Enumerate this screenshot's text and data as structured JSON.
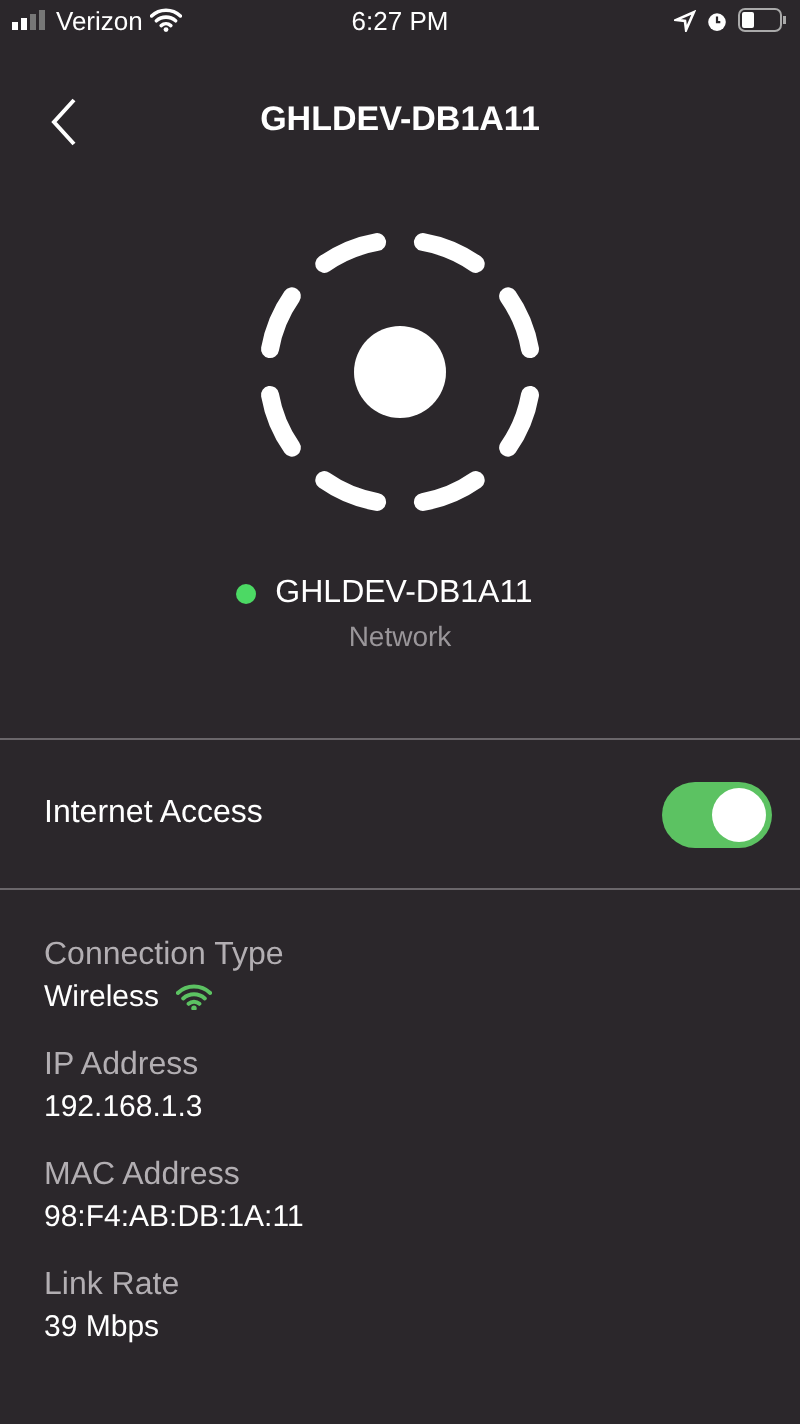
{
  "status_bar": {
    "carrier": "Verizon",
    "time": "6:27 PM"
  },
  "header": {
    "title": "GHLDEV-DB1A11"
  },
  "device": {
    "name": "GHLDEV-DB1A11",
    "subtitle": "Network",
    "color": "#4cd964"
  },
  "internet_access": {
    "label": "Internet Access",
    "on": true
  },
  "details": [
    {
      "kind": "wireless",
      "label": "Connection Type",
      "value": "Wireless"
    },
    {
      "kind": "text",
      "label": "IP Address",
      "value": "192.168.1.3"
    },
    {
      "kind": "text",
      "label": "MAC Address",
      "value": "98:F4:AB:DB:1A:11"
    },
    {
      "kind": "text",
      "label": "Link Rate",
      "value": "39 Mbps"
    }
  ]
}
